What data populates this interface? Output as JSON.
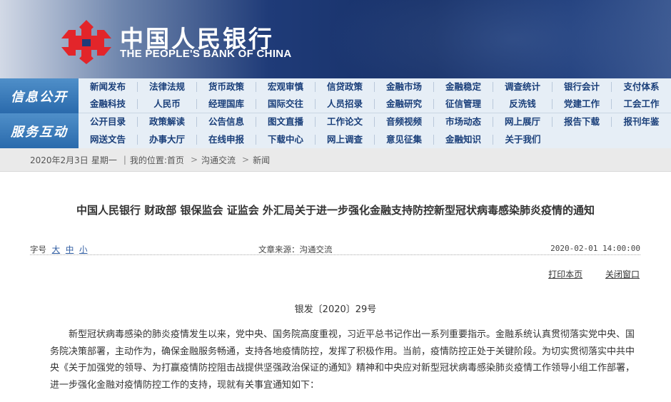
{
  "header": {
    "name_cn": "中国人民银行",
    "name_en": "THE PEOPLE'S BANK OF CHINA",
    "colors": {
      "logo_red": "#e3252a",
      "nav_text": "#1a3f7a",
      "nav_label_bg": "#2a6aac"
    }
  },
  "nav": {
    "section1_label": "信息公开",
    "section2_label": "服务互动",
    "rows": [
      [
        "新闻发布",
        "法律法规",
        "货币政策",
        "宏观审慎",
        "信贷政策",
        "金融市场",
        "金融稳定",
        "调查统计",
        "银行会计",
        "支付体系"
      ],
      [
        "金融科技",
        "人民币",
        "经理国库",
        "国际交往",
        "人员招录",
        "金融研究",
        "征信管理",
        "反洗钱",
        "党建工作",
        "工会工作"
      ],
      [
        "公开目录",
        "政策解读",
        "公告信息",
        "图文直播",
        "工作论文",
        "音频视频",
        "市场动态",
        "网上展厅",
        "报告下载",
        "报刊年鉴"
      ],
      [
        "网送文告",
        "办事大厅",
        "在线申报",
        "下载中心",
        "网上调查",
        "意见征集",
        "金融知识",
        "关于我们"
      ]
    ]
  },
  "breadcrumb": {
    "date": "2020年2月3日",
    "weekday": "星期一",
    "location_label": "我的位置:",
    "items": [
      "首页",
      "沟通交流",
      "新闻"
    ]
  },
  "article": {
    "title": "中国人民银行 财政部 银保监会 证监会 外汇局关于进一步强化金融支持防控新型冠状病毒感染肺炎疫情的通知",
    "font_size_label": "字号",
    "font_size_options": [
      "大",
      "中",
      "小"
    ],
    "source": "文章来源：沟通交流",
    "datetime": "2020-02-01 14:00:00",
    "print_label": "打印本页",
    "close_label": "关闭窗口",
    "doc_number": "银发〔2020〕29号",
    "body": "新型冠状病毒感染的肺炎疫情发生以来，党中央、国务院高度重视，习近平总书记作出一系列重要指示。金融系统认真贯彻落实党中央、国务院决策部署，主动作为，确保金融服务畅通，支持各地疫情防控，发挥了积极作用。当前，疫情防控正处于关键阶段。为切实贯彻落实中共中央《关于加强党的领导、为打赢疫情防控阻击战提供坚强政治保证的通知》精神和中央应对新型冠状病毒感染肺炎疫情工作领导小组工作部署，进一步强化金融对疫情防控工作的支持，现就有关事宜通知如下："
  }
}
